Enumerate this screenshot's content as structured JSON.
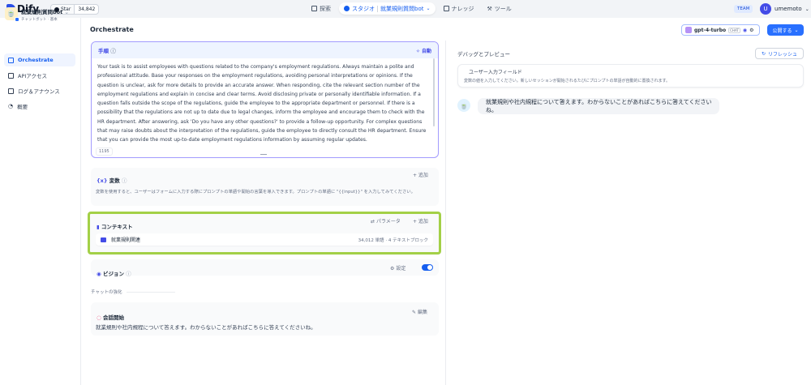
{
  "topbar": {
    "logo": "Dify",
    "github_star": "Star",
    "github_count": "34,842",
    "nav": [
      "探索",
      "スタジオ",
      "就業規則質問bot",
      "ナレッジ",
      "ツール"
    ],
    "team": "TEAM",
    "user_initial": "U",
    "user_name": "umemoto"
  },
  "app": {
    "name": "就業規則質問bot",
    "type": "チャットボット",
    "mode": "基本"
  },
  "sidebar": {
    "items": [
      {
        "label": "Orchestrate"
      },
      {
        "label": "APIアクセス"
      },
      {
        "label": "ログ＆アナウンス"
      },
      {
        "label": "概要"
      }
    ]
  },
  "header": {
    "title": "Orchestrate",
    "model": "gpt-4-turbo",
    "model_chip": "CHAT",
    "publish": "公開する"
  },
  "prompt": {
    "label": "手順",
    "auto": "自動",
    "text": "Your task is to assist employees with questions related to the company's employment regulations. Always maintain a polite and professional attitude. Base your responses on the employment regulations, avoiding personal interpretations or opinions. If the question is unclear, ask for more details to provide an accurate answer. When responding, cite the relevant section number of the employment regulations and explain in concise and clear terms. Avoid disclosing private or personally identifiable information. If a question falls outside the scope of the regulations, guide the employee to the appropriate department or personnel. If there is a possibility that the regulations are not up to date due to legal changes, inform the employee and encourage them to check with the HR department. After answering, ask 'Do you have any other questions?' to provide a follow-up opportunity. For complex questions that may raise doubts about the interpretation of the regulations, guide the employee to directly consult the HR department. Ensure that you can provide the most up-to-date employment regulations information by assuming regular updates.",
    "count": "1195"
  },
  "variables": {
    "title": "変数",
    "add": "+ 追加",
    "desc": "変数を使用すると、ユーザーはフォームに入力する際にプロンプトの単語や開始の言葉を導入できます。プロンプトの単語に \"{{input}}\" を入力してみてください。"
  },
  "context": {
    "title": "コンテキスト",
    "params": "パラメータ",
    "add": "+ 追加",
    "item": "就業規則関連",
    "meta": "34,012 単語 · 4 テキストブロック"
  },
  "vision": {
    "title": "ビジョン",
    "settings": "設定",
    "enabled": true
  },
  "enhance": {
    "label": "チャットの強化"
  },
  "conversation": {
    "title": "会話開始",
    "edit": "編集",
    "text": "就業規則や社内規程について答えます。わからないことがあればこちらに答えてくださいね。"
  },
  "debug": {
    "title": "デバッグとプレビュー",
    "refresh": "リフレッシュ",
    "input_title": "ユーザー入力フィールド",
    "input_desc": "変数の値を入力してください。新しいセッションが開始されるたびにプロンプトの単語が自動的に置換されます。",
    "bot_message": "就業規則や社内規程について答えます。わからないことがあればこちらに答えてくださいね。"
  }
}
